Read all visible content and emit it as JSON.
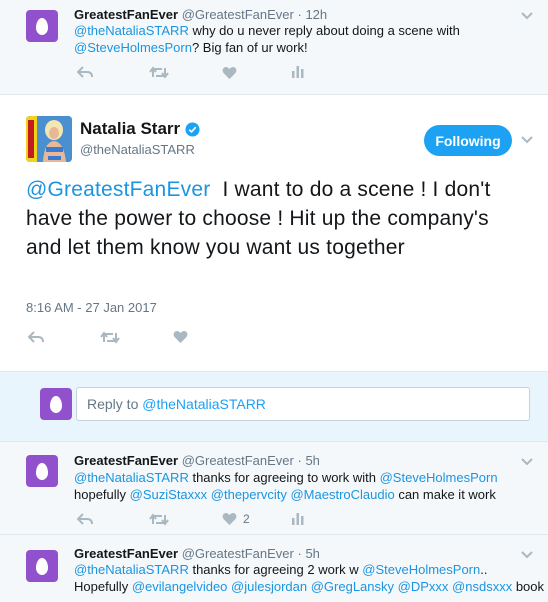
{
  "tweets": [
    {
      "name": "GreatestFanEver",
      "handle": "@GreatestFanEver",
      "sep": " · ",
      "time": "12h",
      "text_parts": [
        "@theNataliaSTARR",
        " why do u never reply about doing a scene with ",
        "@SteveHolmesPorn",
        "? Big fan of ur work!"
      ],
      "likes": ""
    },
    {
      "name": "GreatestFanEver",
      "handle": "@GreatestFanEver",
      "sep": " · ",
      "time": "5h",
      "line1": [
        "@theNataliaSTARR",
        " thanks for agreeing to work with ",
        "@SteveHolmesPorn"
      ],
      "line2": [
        "hopefully ",
        "@SuziStaxxx",
        " ",
        "@thepervcity",
        " ",
        "@MaestroClaudio",
        " can make it work"
      ],
      "likes": "2"
    },
    {
      "name": "GreatestFanEver",
      "handle": "@GreatestFanEver",
      "sep": " · ",
      "time": "5h",
      "line1": [
        "@theNataliaSTARR",
        " thanks for agreeing 2 work w ",
        "@SteveHolmesPorn",
        ".."
      ],
      "line2": [
        "Hopefully ",
        "@evilangelvideo",
        " ",
        "@julesjordan",
        " ",
        "@GregLansky",
        " ",
        "@DPxxx",
        " ",
        "@nsdsxxx",
        " book"
      ]
    }
  ],
  "main": {
    "name": "Natalia Starr",
    "handle": "@theNataliaSTARR",
    "follow_label": "Following",
    "mention": "@GreatestFanEver",
    "text": "  I want to do a scene ! I don't have the power to choose ! Hit up the company's and let them know you want us together",
    "timestamp": "8:16 AM - 27 Jan 2017"
  },
  "reply": {
    "placeholder": "Reply to ",
    "mention": "@theNataliaSTARR"
  },
  "colors": {
    "accent": "#1da1f2",
    "link": "#1b95e0",
    "egg_avatar": "#9150cc",
    "icon": "#aab8c2"
  }
}
